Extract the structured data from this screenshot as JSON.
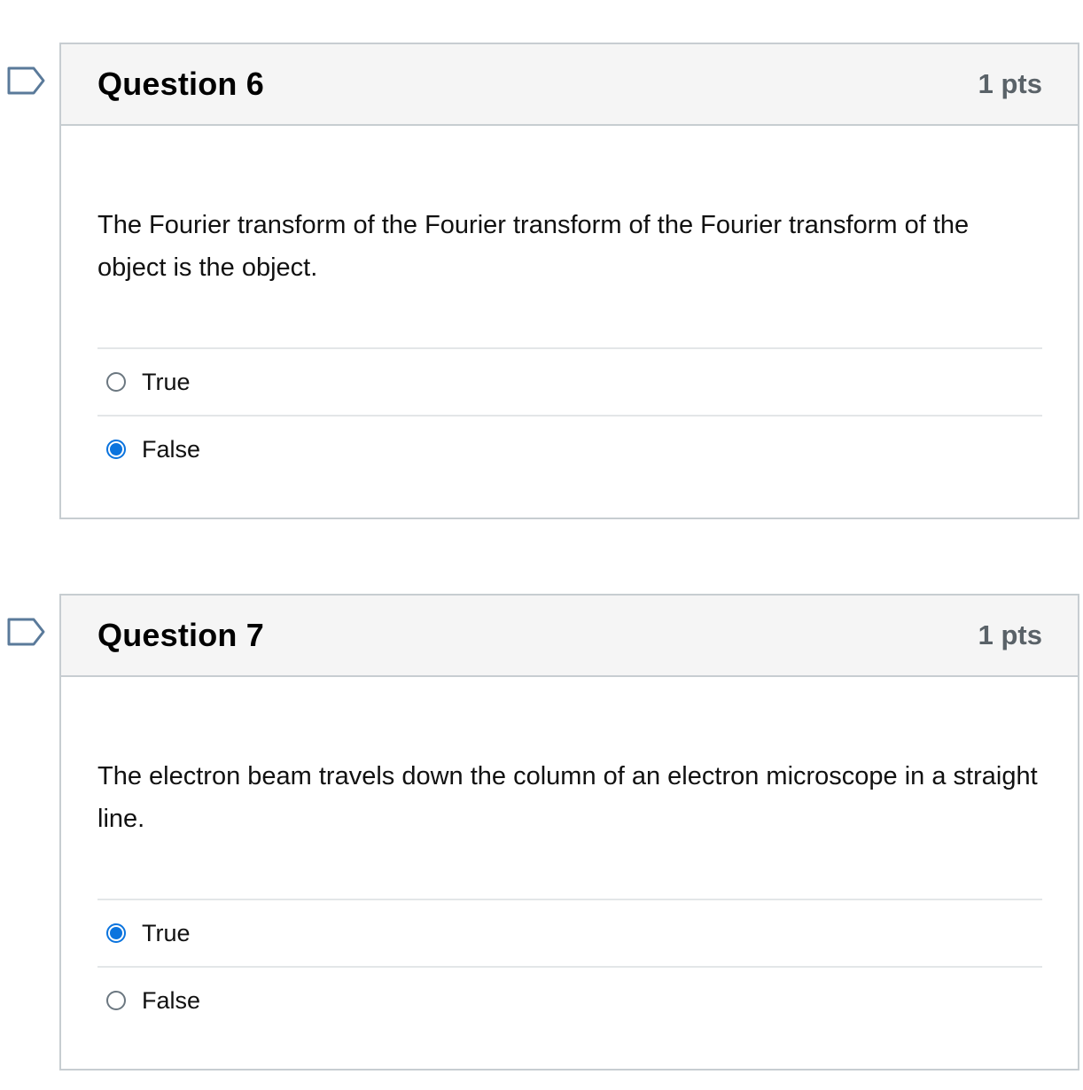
{
  "questions": [
    {
      "title": "Question 6",
      "points": "1 pts",
      "text": "The Fourier transform of the Fourier transform of the Fourier transform of the object is the object.",
      "answers": [
        {
          "label": "True",
          "selected": false
        },
        {
          "label": "False",
          "selected": true
        }
      ]
    },
    {
      "title": "Question 7",
      "points": "1 pts",
      "text": "The electron beam travels down the column of an electron microscope in a straight line.",
      "answers": [
        {
          "label": "True",
          "selected": true
        },
        {
          "label": "False",
          "selected": false
        }
      ]
    }
  ],
  "colors": {
    "header_bg": "#f5f5f5",
    "border": "#c7cdd1",
    "radio_selected": "#0b74de",
    "flag_stroke": "#5a7a9a"
  },
  "icons": {
    "flag": "flag-question-icon",
    "radio_on": "radio-selected",
    "radio_off": "radio-unselected"
  }
}
